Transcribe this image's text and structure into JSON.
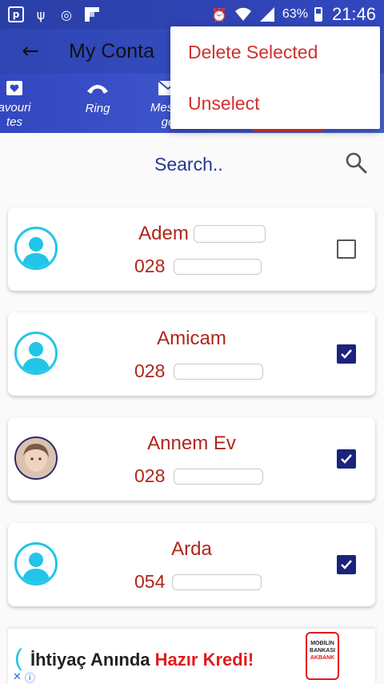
{
  "status_bar": {
    "icons": [
      "p-app-icon",
      "usb-icon",
      "sync-icon",
      "flipboard-icon",
      "alarm-icon",
      "wifi-icon",
      "signal-icon",
      "battery-icon"
    ],
    "battery": "63%",
    "time": "21:46"
  },
  "toolbar": {
    "title": "My Conta"
  },
  "tabs": [
    {
      "label": "avouri\ntes",
      "icon": "heart-folder-icon"
    },
    {
      "label": "Ring",
      "icon": "phone-icon"
    },
    {
      "label": "Messa\nge",
      "icon": "mail-icon"
    }
  ],
  "menu": {
    "items": [
      "Delete Selected",
      "Unselect"
    ]
  },
  "search": {
    "placeholder": "Search.."
  },
  "contacts": [
    {
      "name": "Adem",
      "phone": "028",
      "checked": false,
      "avatar": "generic"
    },
    {
      "name": "Amicam",
      "phone": "028",
      "checked": true,
      "avatar": "generic"
    },
    {
      "name": "Annem Ev",
      "phone": "028",
      "checked": true,
      "avatar": "photo"
    },
    {
      "name": "Arda",
      "phone": "054",
      "checked": true,
      "avatar": "generic"
    }
  ],
  "ad": {
    "text_prefix": "İhtiyaç Anında",
    "text_highlight": "Hazır Kredi!",
    "logo_line1": "MOBİLİN",
    "logo_line2": "BANKASI",
    "logo_line3": "AKBANK",
    "colors": {
      "brand_red": "#e21b1b"
    }
  },
  "colors": {
    "header": "#2e45b3",
    "name_text": "#b0251a",
    "menu_text": "#d32f2f",
    "checkbox_on": "#1a237e",
    "avatar_ring": "#22c5e8"
  }
}
